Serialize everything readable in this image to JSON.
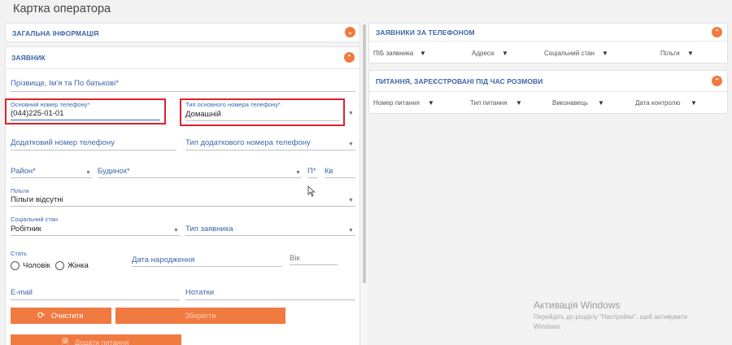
{
  "page_title": "Картка оператора",
  "left": {
    "general_info": {
      "title": "ЗАГАЛЬНА ІНФОРМАЦІЯ",
      "chevron": "chevron-down-icon"
    },
    "applicant": {
      "title": "ЗАЯВНИК",
      "chevron": "chevron-up-icon",
      "full_name_label": "Прізвище, Ім'я та По батькові*",
      "main_phone_label": "Основний номер телефону*",
      "main_phone_value": "(044)225-01-01",
      "main_phone_type_label": "Тип основного номера телефону*",
      "main_phone_type_value": "Домашній",
      "extra_phone_label": "Додатковий номер телефону",
      "extra_phone_type_label": "Тип додаткового номера телефону",
      "district_label": "Район*",
      "building_label": "Будинок*",
      "entrance_label": "П*",
      "apartment_label": "Кв",
      "benefits_label": "Пільги",
      "benefits_value": "Пільги відсутні",
      "social_status_label": "Соціальний стан",
      "social_status_value": "Робітник",
      "applicant_type_label": "Тип заявника",
      "gender_label": "Стать",
      "gender_options": [
        "Чоловік",
        "Жінка"
      ],
      "birth_date_label": "Дата народження",
      "age_label": "Вік",
      "email_label": "E-mail",
      "notes_label": "Нотатки",
      "clear_button": "Очистити",
      "save_button": "Зберегти",
      "add_question_button": "Додати питання"
    }
  },
  "right": {
    "phone_applicants": {
      "title": "ЗАЯВНИКИ ЗА ТЕЛЕФОНОМ",
      "columns": [
        "ПІБ заявника",
        "Адреса",
        "Соціальний стан",
        "Пільги"
      ]
    },
    "registered_questions": {
      "title": "ПИТАННЯ, ЗАРЕЄСТРОВАНІ ПІД ЧАС РОЗМОВИ",
      "columns": [
        "Номер питання",
        "Тип питання",
        "Виконавець",
        "Дата контролю"
      ]
    }
  },
  "watermark": {
    "title": "Активація Windows",
    "line1": "Перейдіть до розділу \"Настройки\", щоб активувати",
    "line2": "Windows."
  },
  "colors": {
    "accent": "#f07a40",
    "label_blue": "#3d66a8",
    "highlight_red": "#e0202a"
  }
}
